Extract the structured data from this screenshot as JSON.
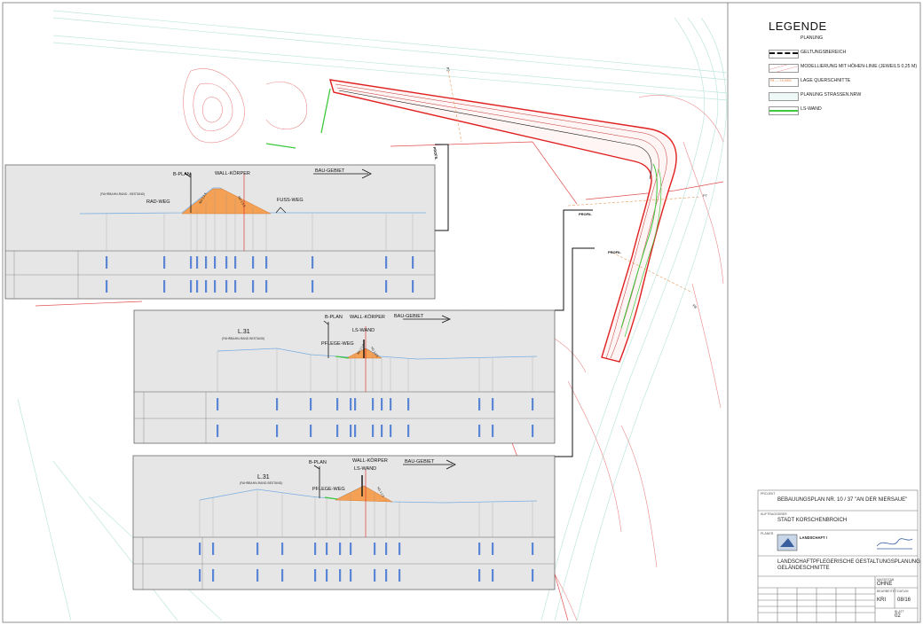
{
  "legend": {
    "title": "LEGENDE",
    "planung": "PLANUNG",
    "items": [
      {
        "label": "GELTUNGSBEREICH",
        "color": "#111111"
      },
      {
        "label": "MODELLIERUNG MIT HÖHEN-LINIE (JEWEILS 0,25 M)",
        "color": "#e06060"
      },
      {
        "label": "LAGE QUERSCHNITTE",
        "color": "#e89a5a"
      },
      {
        "label": "PLANUNG STRASSEN.NRW",
        "color": "#8fd3c8"
      },
      {
        "label": "LS-WAND",
        "color": "#3ec93e"
      }
    ]
  },
  "title_block": {
    "project_label": "PROJEKT",
    "project": "BEBAUUNGSPLAN NR. 10 / 37 \"AN DER NIERSAUE\"",
    "client_label": "AUFTRAGGEBER",
    "client": "STADT KORSCHENBROICH",
    "planer_label": "PLANER",
    "firm": "LANDSCHAFT !",
    "drawing_title_1": "LANDSCHAFTPFLEGERISCHE GESTALTUNGSPLANUNG",
    "drawing_title_2": "GELÄNDESCHNITTE",
    "scale_label": "MASSSTAB",
    "scale": "OHNE",
    "drawn_label": "BEARBEITET",
    "drawn": "KRI",
    "date_label": "DATUM",
    "date": "08/16",
    "sheet_label": "BLATT",
    "sheet": "02"
  },
  "sections": [
    {
      "labels": {
        "bplan": "B-PLAN",
        "wall": "WALL-KÖRPER",
        "bau": "BAU-GEBIET",
        "rad": "RAD-WEG",
        "fuss": "FUSS-WEG",
        "fahrbahn": "(FAHRBAHN-RAND - BESTAND)",
        "slope": "NG 1:1.5"
      },
      "tag": "PROFIL"
    },
    {
      "labels": {
        "bplan": "B-PLAN",
        "wall": "WALL-KÖRPER",
        "bau": "BAU-GEBIET",
        "lswand": "LS-WAND",
        "pflege": "PFLEGE-WEG",
        "road": "L.31",
        "fahrbahn": "(FAHRBAHN-RAND BESTAND)",
        "slope": "NG 1:1.5"
      },
      "tag": "PROFIL"
    },
    {
      "labels": {
        "bplan": "B-PLAN",
        "wall": "WALL-KÖRPER",
        "bau": "BAU-GEBIET",
        "lswand": "LS-WAND",
        "pflege": "PFLEGE-WEG",
        "road": "L.31",
        "fahrbahn": "(FAHRBAHN-RAND-BESTAND)",
        "slope": "NG 1:1.5"
      },
      "tag": "PROFIL"
    }
  ],
  "map_markers": {
    "p2": "P2",
    "p7": "P7",
    "p8": "P8",
    "marker1": "PROFIL",
    "marker2": "PROFIL",
    "marker3": "PROFIL"
  },
  "colors": {
    "boundary": "#e02020",
    "contour": "#e06060",
    "road": "#8fd3c8",
    "fill": "#f4a055",
    "lswand": "#3ec93e",
    "section_bg": "#e6e6e6",
    "tick": "#3a6fd8",
    "terrain": "#79aee0"
  }
}
